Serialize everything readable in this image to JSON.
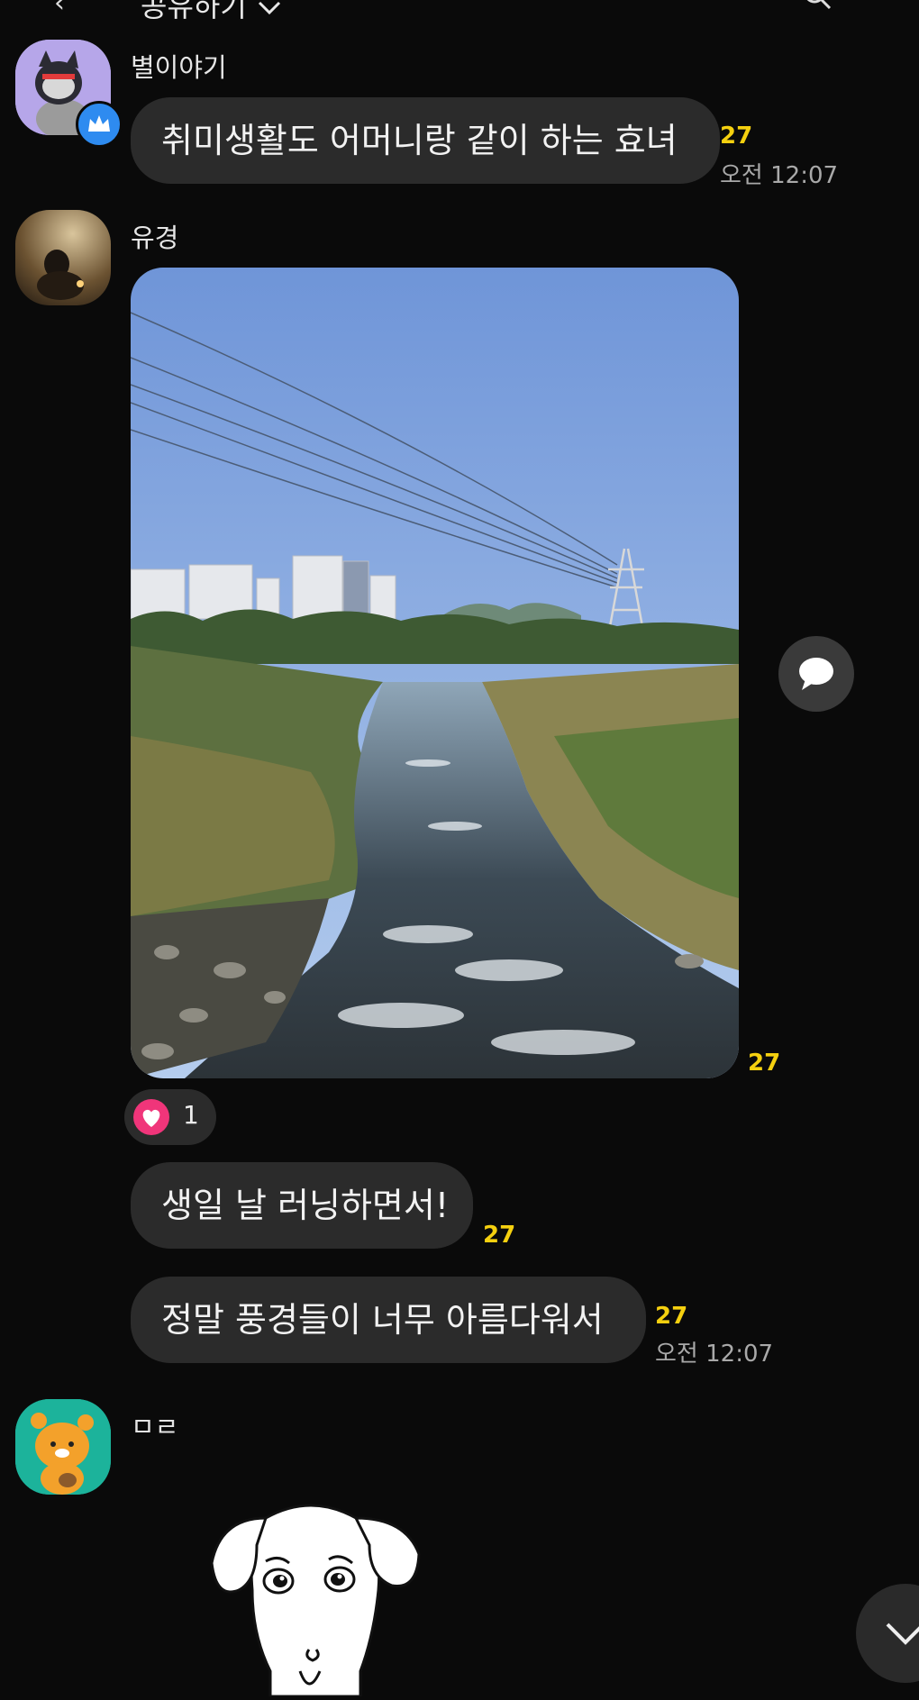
{
  "header": {
    "title": "공유하기",
    "chevron": "chevron-down-icon"
  },
  "messages": [
    {
      "sender": "별이야기",
      "text": "취미생활도 어머니랑 같이 하는 효녀",
      "unread": "27",
      "time": "오전 12:07"
    },
    {
      "sender": "유경",
      "photo_unread": "27",
      "reaction_count": "1",
      "texts": [
        {
          "text": "생일 날 러닝하면서!",
          "unread": "27"
        },
        {
          "text": "정말 풍경들이 너무 아름다워서",
          "unread": "27",
          "time": "오전 12:07"
        }
      ]
    },
    {
      "sender": "ㅁㄹ"
    }
  ],
  "colors": {
    "background": "#0a0a0a",
    "bubble": "#2b2b2b",
    "unread": "#f5d00f",
    "heart": "#f0357a",
    "admin_badge": "#2e8bf0"
  },
  "icons": [
    "crown-icon",
    "speech-bubble-icon",
    "heart-icon",
    "chevron-down-icon"
  ]
}
